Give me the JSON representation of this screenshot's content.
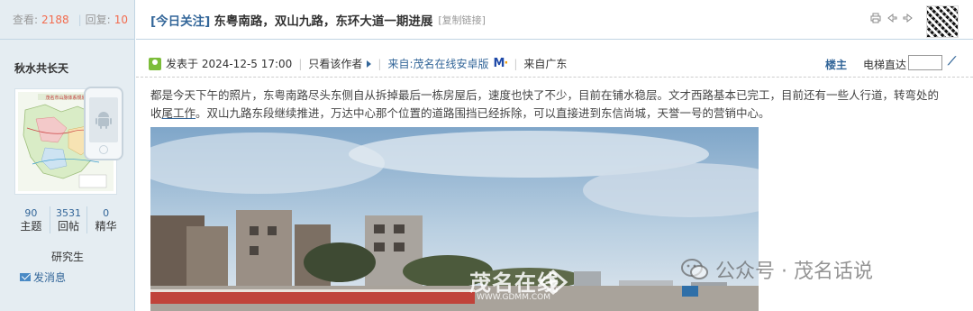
{
  "stats": {
    "views_label": "查看:",
    "views": "2188",
    "replies_label": "回复:",
    "replies": "10"
  },
  "author": {
    "name": "秋水共长天",
    "avatar_title": "茂名市山脉体系规划",
    "counts": [
      {
        "num": "90",
        "label": "主题"
      },
      {
        "num": "3531",
        "label": "回帖"
      },
      {
        "num": "0",
        "label": "精华"
      }
    ],
    "rank": "研究生",
    "pm": "发消息"
  },
  "thread": {
    "category": "[今日关注]",
    "subject": "东粤南路，双山九路，东环大道一期进展",
    "copy_link": "[复制链接]"
  },
  "post": {
    "posted_at": "发表于 2024-12-5 17:00",
    "only_author": "只看该作者",
    "from_app": "来自:茂名在线安卓版",
    "from_region": "来自广东",
    "floor": "楼主",
    "elevator": "电梯直达",
    "body_part1": "都是今天下午的照片，东粤南路尽头东侧自从拆掉最后一栋房屋后，速度也快了不少，目前在铺水稳层。文才西路基本已完工，目前还有一些人行道，转弯处的收",
    "body_part2_u": "尾工作",
    "body_part3": "。双山九路东段继续推进，万达中心那个位置的道路围挡已经拆除，可以直接进到东信尚城，天誉一号的营销中心。"
  },
  "watermarks": {
    "gdmm": "茂名在线",
    "gdmm_url": "WWW.GDMM.COM",
    "wechat": "公众号 · 茂名话说"
  },
  "icons": [
    "print-icon",
    "prev-icon",
    "next-icon",
    "qr-code-icon",
    "online-status-icon",
    "mail-icon",
    "android-icon"
  ]
}
